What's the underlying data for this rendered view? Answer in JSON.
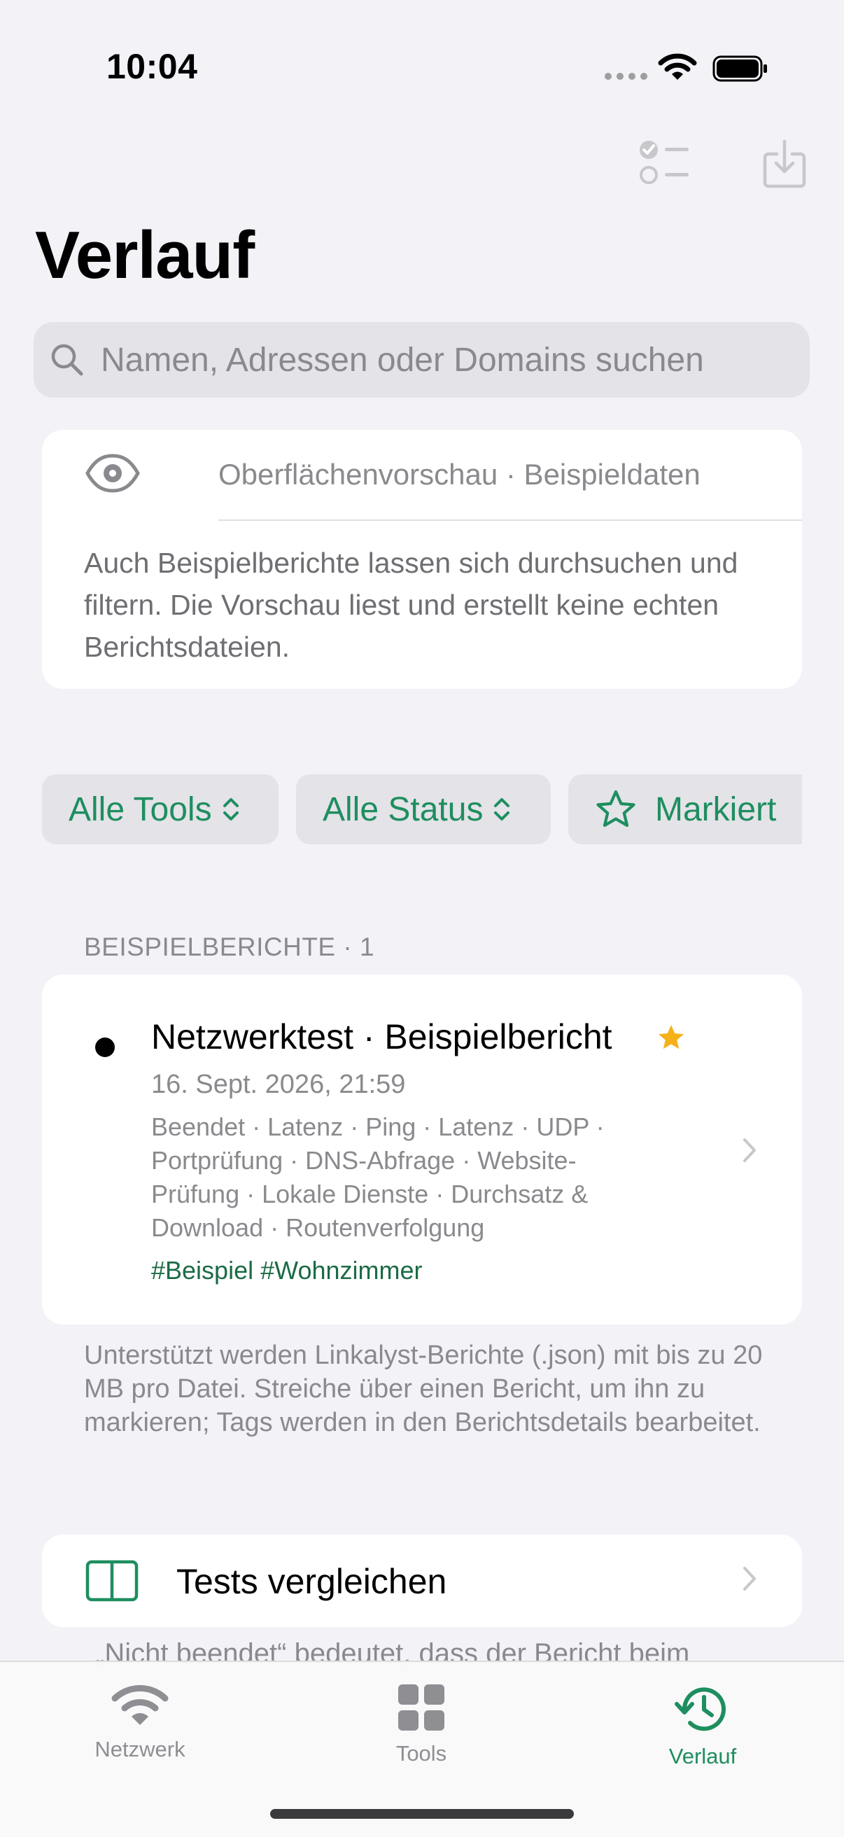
{
  "status_bar": {
    "time": "10:04"
  },
  "colors": {
    "accent": "#1E8E5F",
    "tag_green": "#1B6B45",
    "star": "#F5B11A",
    "background": "#F2F2F7"
  },
  "toolbar": {
    "select_icon": "checklist-icon",
    "import_icon": "tray-download-icon"
  },
  "page": {
    "title": "Verlauf"
  },
  "search": {
    "placeholder": "Namen, Adressen oder Domains suchen"
  },
  "preview_notice": {
    "icon": "eye-icon",
    "heading": "Oberflächenvorschau · Beispieldaten",
    "body": "Auch Beispielberichte lassen sich durchsuchen und filtern. Die Vorschau liest und erstellt keine echten Berichtsdateien."
  },
  "filters": [
    {
      "label": "Alle Tools",
      "icon": "chevron-updown-icon"
    },
    {
      "label": "Alle Status",
      "icon": "chevron-updown-icon"
    },
    {
      "label": "Markiert",
      "icon": "star-outline-icon"
    }
  ],
  "section": {
    "header": "BEISPIELBERICHTE · 1"
  },
  "report": {
    "title": "Netzwerktest · Beispielbericht",
    "starred": true,
    "date": "16. Sept. 2026, 21:59",
    "summary_lines": [
      "Beendet · Latenz · Ping · Latenz · UDP ·",
      "Portprüfung · DNS-Abfrage · Website-",
      "Prüfung · Lokale Dienste · Durchsatz &",
      "Download · Routenverfolgung"
    ],
    "hashtags": "#Beispiel #Wohnzimmer"
  },
  "footnote": "Unterstützt werden Linkalyst-Berichte (.json) mit bis zu 20 MB pro Datei. Streiche über einen Bericht, um ihn zu markieren; Tags werden in den Berichtsdetails bearbeitet.",
  "compare": {
    "label": "Tests vergleichen",
    "icon": "split-view-icon"
  },
  "peek_text": "„Nicht beendet“ bedeutet, dass der Bericht beim",
  "tabs": [
    {
      "label": "Netzwerk",
      "icon": "wifi-icon",
      "active": false
    },
    {
      "label": "Tools",
      "icon": "grid-icon",
      "active": false
    },
    {
      "label": "Verlauf",
      "icon": "history-clock-icon",
      "active": true
    }
  ]
}
